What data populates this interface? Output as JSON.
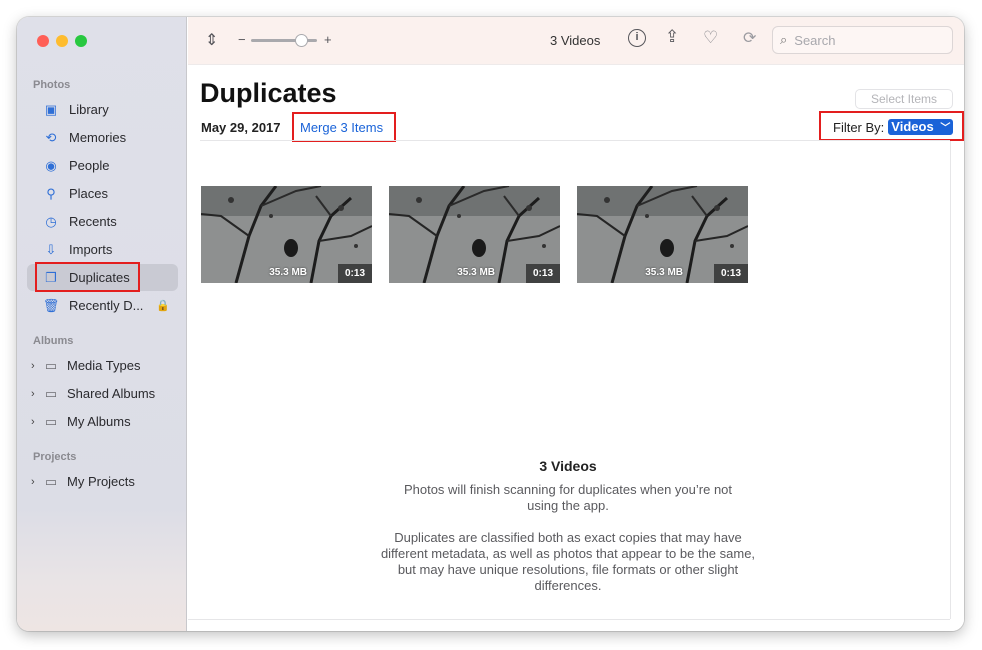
{
  "window": {
    "traffic_colors": [
      "#ff5f57",
      "#febc2e",
      "#28c840"
    ]
  },
  "sidebar": {
    "photos_section": "Photos",
    "items": [
      {
        "label": "Library",
        "icon": "photo-library-icon"
      },
      {
        "label": "Memories",
        "icon": "memories-icon"
      },
      {
        "label": "People",
        "icon": "people-icon"
      },
      {
        "label": "Places",
        "icon": "places-pin-icon"
      },
      {
        "label": "Recents",
        "icon": "clock-icon"
      },
      {
        "label": "Imports",
        "icon": "import-icon"
      },
      {
        "label": "Duplicates",
        "icon": "duplicates-icon"
      },
      {
        "label": "Recently D...",
        "icon": "trash-icon"
      }
    ],
    "albums_section": "Albums",
    "albums": [
      {
        "label": "Media Types",
        "icon": "folder-icon"
      },
      {
        "label": "Shared Albums",
        "icon": "shared-folder-icon"
      },
      {
        "label": "My Albums",
        "icon": "folder-icon"
      }
    ],
    "projects_section": "Projects",
    "projects": [
      {
        "label": "My Projects",
        "icon": "folder-icon"
      }
    ]
  },
  "toolbar": {
    "zoom_minus": "−",
    "zoom_plus": "+",
    "count_label": "3 Videos",
    "search_placeholder": "Search"
  },
  "main": {
    "title": "Duplicates",
    "date": "May 29, 2017",
    "merge_label": "Merge 3 Items",
    "select_items": "Select Items",
    "filter_label": "Filter By:",
    "filter_value": "Videos",
    "thumbnails": [
      {
        "size": "35.3 MB",
        "duration": "0:13"
      },
      {
        "size": "35.3 MB",
        "duration": "0:13"
      },
      {
        "size": "35.3 MB",
        "duration": "0:13"
      }
    ],
    "summary_title": "3 Videos",
    "summary_line1": "Photos will finish scanning for duplicates when you’re not using the app.",
    "summary_line2": "Duplicates are classified both as exact copies that may have different metadata, as well as photos that appear to be the same, but may have unique resolutions, file formats or other slight differences."
  }
}
